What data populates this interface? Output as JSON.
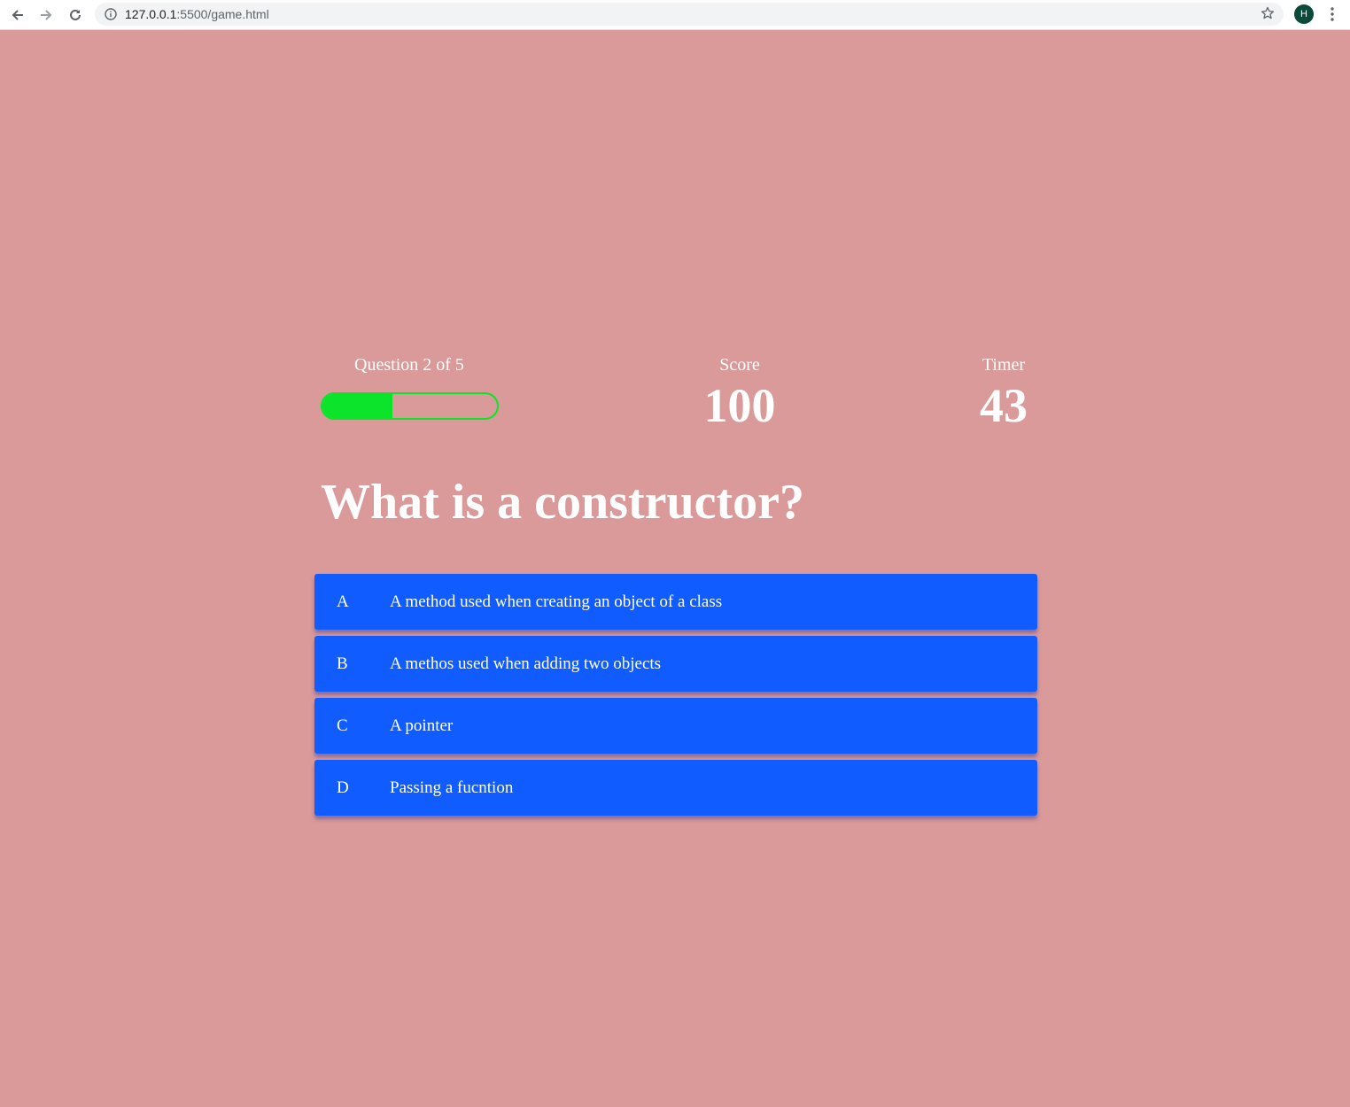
{
  "browser": {
    "url_host": "127.0.0.1",
    "url_path": ":5500/game.html",
    "profile_initial": "H",
    "icons": [
      "back-arrow-icon",
      "forward-arrow-icon",
      "reload-icon",
      "info-icon",
      "star-icon",
      "more-vert-icon"
    ]
  },
  "hud": {
    "progress_text": "Question 2 of 5",
    "progress_fraction": 0.4,
    "score_label": "Score",
    "score_value": "100",
    "timer_label": "Timer",
    "timer_value": "43"
  },
  "question": "What is a constructor?",
  "choices": [
    {
      "prefix": "A",
      "text": "A method used when creating an object of a class"
    },
    {
      "prefix": "B",
      "text": "A methos used when adding two objects"
    },
    {
      "prefix": "C",
      "text": "A pointer"
    },
    {
      "prefix": "D",
      "text": "Passing a fucntion"
    }
  ],
  "colors": {
    "background": "#da9a9a",
    "choice": "#105cff",
    "progress": "#0ce42b",
    "text": "#ffffff"
  }
}
